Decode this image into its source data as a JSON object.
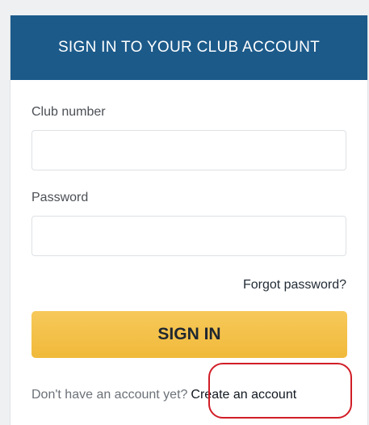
{
  "header": {
    "title": "SIGN IN TO YOUR CLUB ACCOUNT",
    "background_color": "#1c5a8a"
  },
  "form": {
    "club_number_label": "Club number",
    "club_number_value": "",
    "password_label": "Password",
    "password_value": "",
    "forgot_password_link": "Forgot password?",
    "sign_in_button": "SIGN IN",
    "button_color": "#f0b93a"
  },
  "footer": {
    "no_account_text": "Don't have an account yet?",
    "create_account_link": "Create an account"
  },
  "annotation": {
    "highlight_color": "#d11d27"
  }
}
